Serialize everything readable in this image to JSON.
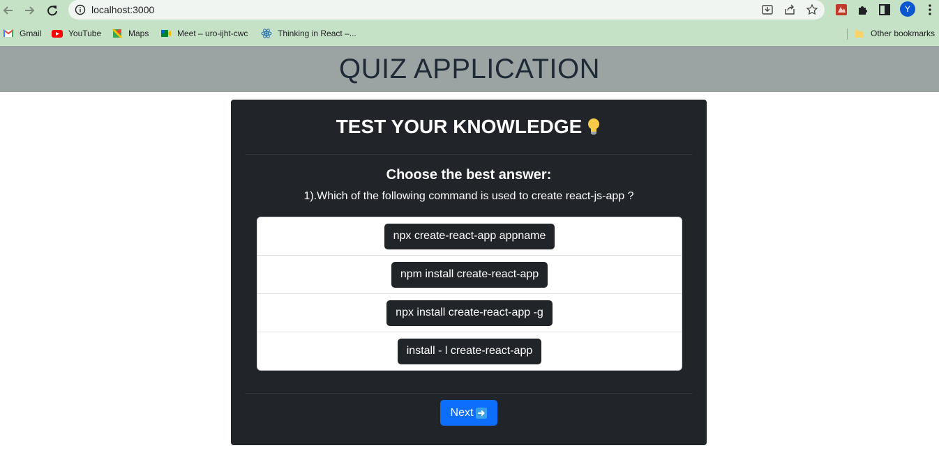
{
  "browser": {
    "url": "localhost:3000",
    "avatar_letter": "Y",
    "bookmarks": [
      {
        "label": "Gmail",
        "icon": "gmail-icon"
      },
      {
        "label": "YouTube",
        "icon": "youtube-icon"
      },
      {
        "label": "Maps",
        "icon": "maps-icon"
      },
      {
        "label": "Meet – uro-ijht-cwc",
        "icon": "meet-icon"
      },
      {
        "label": "Thinking in React –...",
        "icon": "react-icon"
      }
    ],
    "other_bookmarks": "Other bookmarks"
  },
  "app": {
    "title": "QUIZ APPLICATION",
    "card_title": "TEST YOUR KNOWLEDGE",
    "card_title_icon": "lightbulb-icon",
    "instruction": "Choose the best answer:",
    "question": "1).Which of the following command is used to create react-js-app ?",
    "options": [
      "npx create-react-app appname",
      "npm install create-react-app",
      "npx install create-react-app -g",
      "install - l create-react-app"
    ],
    "next_label": "Next",
    "next_icon": "right-arrow-icon"
  },
  "colors": {
    "banner": "#9ba3a3",
    "card": "#212529",
    "primary": "#0d6efd",
    "chrome": "#c6e2c6"
  }
}
